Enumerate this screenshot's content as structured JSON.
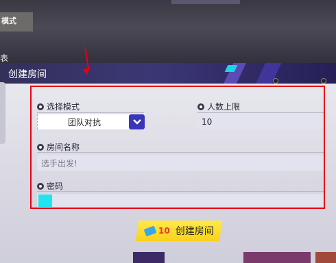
{
  "background": {
    "fragment_top": "模式",
    "fragment_left": "表"
  },
  "dialog": {
    "title": "创建房间",
    "mode": {
      "label": "选择模式",
      "value": "团队对抗"
    },
    "player_limit": {
      "label": "人数上限",
      "value": "10"
    },
    "room_name": {
      "label": "房间名称",
      "placeholder": "选手出发!"
    },
    "password": {
      "label": "密码",
      "value": ""
    },
    "create_button": {
      "cost": "10",
      "label": "创建房间"
    }
  },
  "colors": {
    "accent": "#3b35b8",
    "button": "#f8d21a",
    "annotation": "#e60012"
  }
}
